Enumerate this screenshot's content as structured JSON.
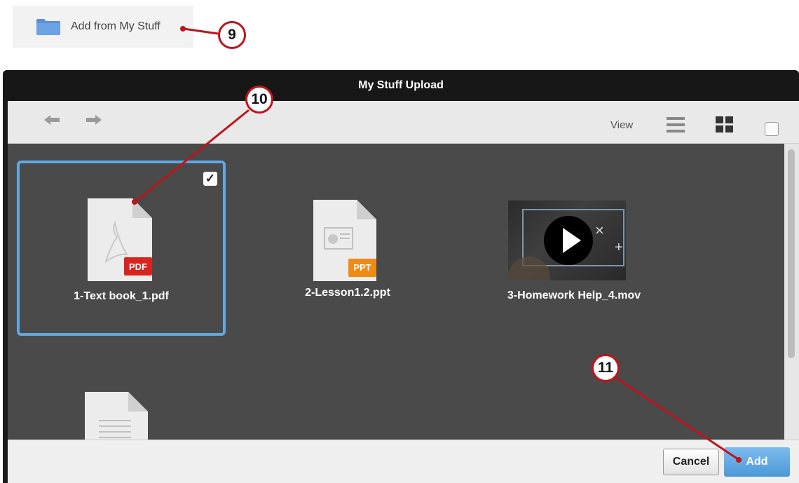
{
  "top_action": {
    "label": "Add from My Stuff",
    "icon": "folder-icon"
  },
  "callouts": {
    "c9": "9",
    "c10": "10",
    "c11": "11"
  },
  "dialog": {
    "title": "My Stuff Upload",
    "toolbar": {
      "back_icon": "arrow-left-icon",
      "forward_icon": "arrow-right-icon",
      "view_label": "View",
      "list_icon": "list-view-icon",
      "grid_icon": "grid-view-icon"
    },
    "files": [
      {
        "name": "1-Text book_1.pdf",
        "badge": "PDF",
        "type": "pdf",
        "selected": true
      },
      {
        "name": "2-Lesson1.2.ppt",
        "badge": "PPT",
        "type": "ppt",
        "selected": false
      },
      {
        "name": "3-Homework Help_4.mov",
        "type": "video",
        "selected": false
      },
      {
        "name": "",
        "type": "doc",
        "selected": false
      }
    ],
    "footer": {
      "cancel_label": "Cancel",
      "add_label": "Add"
    }
  },
  "colors": {
    "accent": "#5ea8e4",
    "callout": "#c0141b",
    "pdf_badge": "#d9231f",
    "ppt_badge": "#ef8a16"
  }
}
